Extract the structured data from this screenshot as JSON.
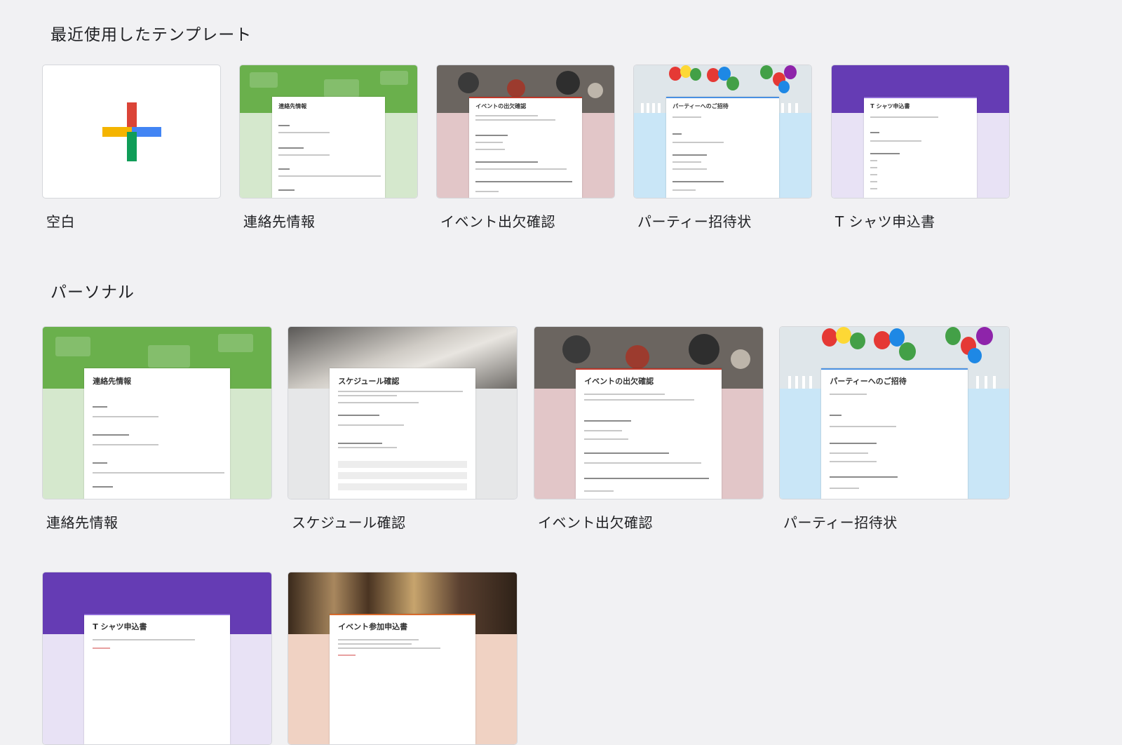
{
  "sections": {
    "recent": {
      "title": "最近使用したテンプレート",
      "items": [
        {
          "label": "空白"
        },
        {
          "label": "連絡先情報",
          "form_title": "連絡先情報"
        },
        {
          "label": "イベント出欠確認",
          "form_title": "イベントの出欠確認"
        },
        {
          "label": "パーティー招待状",
          "form_title": "パーティーへのご招待"
        },
        {
          "label": "T シャツ申込書",
          "form_title": "T シャツ申込書"
        }
      ]
    },
    "personal": {
      "title": "パーソナル",
      "items": [
        {
          "label": "連絡先情報",
          "form_title": "連絡先情報"
        },
        {
          "label": "スケジュール確認",
          "form_title": "スケジュール確認"
        },
        {
          "label": "イベント出欠確認",
          "form_title": "イベントの出欠確認"
        },
        {
          "label": "パーティー招待状",
          "form_title": "パーティーへのご招待"
        },
        {
          "label": "",
          "form_title": "T シャツ申込書"
        },
        {
          "label": "",
          "form_title": "イベント参加申込書"
        }
      ]
    }
  },
  "icons": {
    "blank": "plus-icon"
  },
  "colors": {
    "background": "#f1f1f3",
    "green": "#6ab04c",
    "purple": "#653cb4",
    "blue": "#4285f4",
    "red": "#db4437",
    "yellow": "#f4b400"
  }
}
